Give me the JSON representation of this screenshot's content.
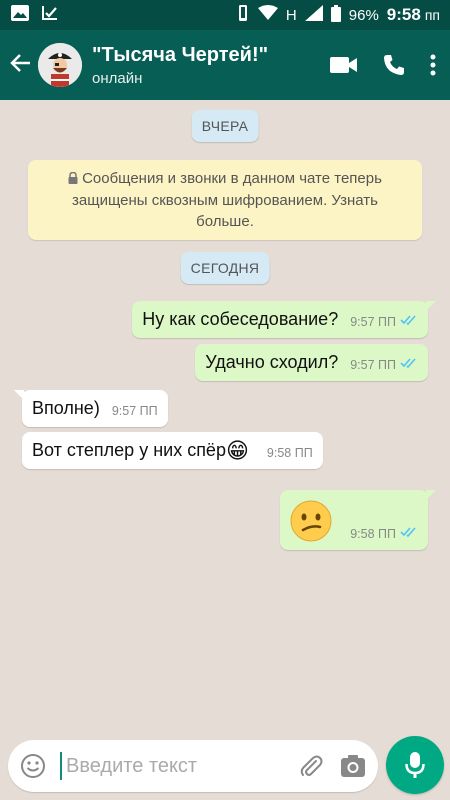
{
  "status_bar": {
    "network": "H",
    "battery": "96%",
    "time": "9:58",
    "ampm": "пп"
  },
  "header": {
    "title": "\"Тысяча Чертей!\"",
    "subtitle": "онлайн",
    "icons": [
      "back-arrow-icon",
      "video-call-icon",
      "phone-icon",
      "more-icon"
    ]
  },
  "chat": {
    "date_yesterday": "ВЧЕРА",
    "encryption_notice": "Сообщения и звонки в данном чате теперь защищены сквозным шифрованием. Узнать больше.",
    "date_today": "СЕГОДНЯ",
    "messages": [
      {
        "text": "Ну как собеседование?",
        "time": "9:57 ПП",
        "direction": "out",
        "read": true
      },
      {
        "text": "Удачно сходил?",
        "time": "9:57 ПП",
        "direction": "out",
        "read": true
      },
      {
        "text": "Вполне)",
        "time": "9:57 ПП",
        "direction": "in"
      },
      {
        "text": "Вот степлер у них спёр",
        "emoji": "😁",
        "time": "9:58 ПП",
        "direction": "in"
      },
      {
        "text": "",
        "emoji": "😕",
        "time": "9:58 ПП",
        "direction": "out",
        "read": true
      }
    ]
  },
  "input": {
    "placeholder": "Введите текст"
  },
  "colors": {
    "header": "#075e54",
    "status_bar": "#054d44",
    "outgoing_bubble": "#dcf8c6",
    "incoming_bubble": "#ffffff",
    "read_ticks": "#4fc3f7",
    "accent": "#00a884"
  }
}
